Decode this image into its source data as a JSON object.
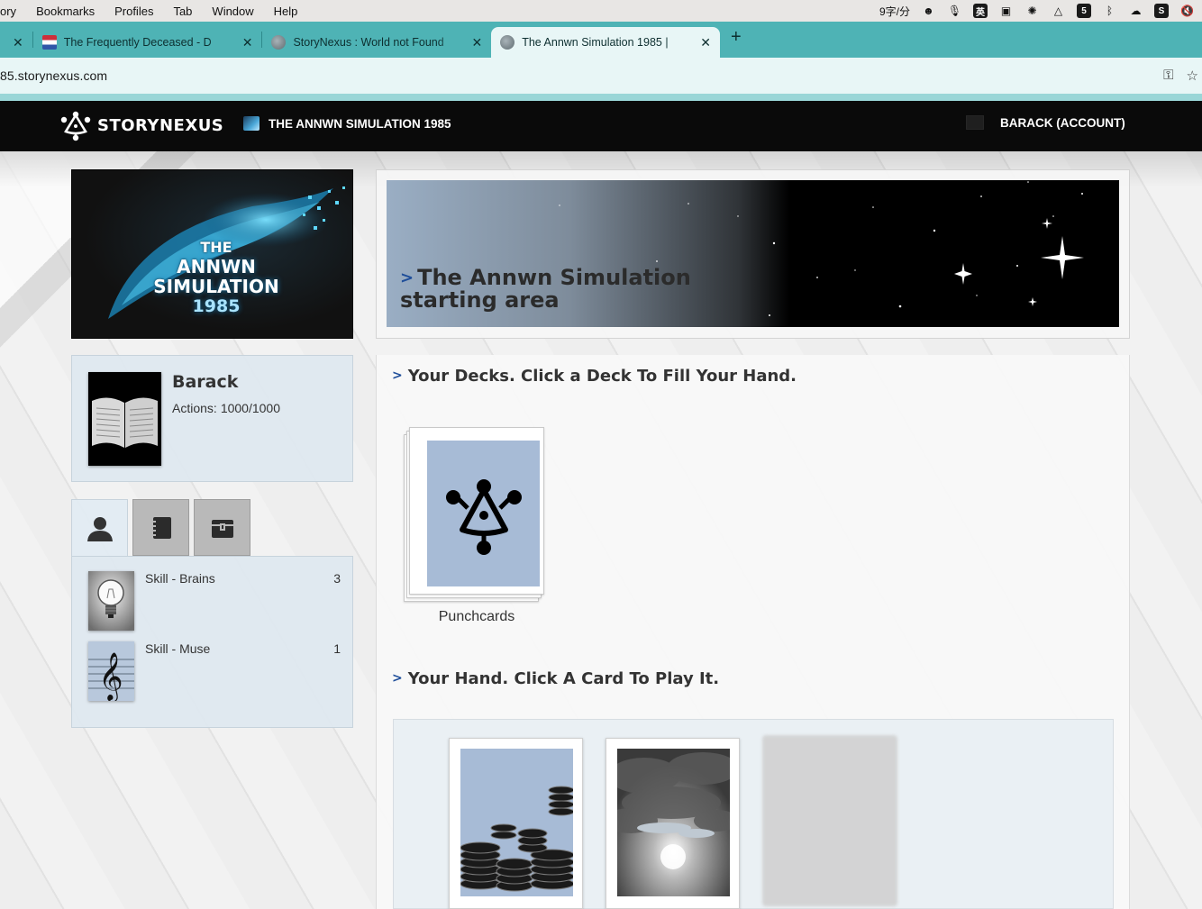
{
  "menubar": {
    "items": [
      "ory",
      "Bookmarks",
      "Profiles",
      "Tab",
      "Window",
      "Help"
    ],
    "tray_text": "9字/分",
    "tray_box_1": "英",
    "tray_box_2": "5"
  },
  "tabs": [
    {
      "title": "The Frequently Deceased - D",
      "favicon": "flag-icon",
      "active": false
    },
    {
      "title": "StoryNexus : World not Found",
      "favicon": "globe-icon",
      "active": false
    },
    {
      "title": "The Annwn Simulation 1985 |",
      "favicon": "globe-icon",
      "active": true
    }
  ],
  "address_bar": {
    "url": "85.storynexus.com"
  },
  "site_header": {
    "logo_text": "STORYNEXUS",
    "world_name": "THE ANNWN SIMULATION 1985",
    "account_label": "BARACK (ACCOUNT)"
  },
  "world_banner": {
    "line1": "THE",
    "line2": "ANNWN",
    "line3": "SIMULATION",
    "line4": "1985"
  },
  "character": {
    "name": "Barack",
    "actions_label": "Actions:",
    "actions_value": "1000/1000"
  },
  "qualities": [
    {
      "name": "Skill - Brains",
      "level": "3",
      "icon": "lightbulb-icon"
    },
    {
      "name": "Skill - Muse",
      "level": "1",
      "icon": "treble-clef-icon"
    }
  ],
  "area": {
    "chevron": ">",
    "title": "The Annwn Simulation starting area"
  },
  "decks": {
    "heading": "Your Decks. Click a Deck To Fill Your Hand.",
    "items": [
      {
        "name": "Punchcards",
        "icon": "storynexus-symbol-icon"
      }
    ]
  },
  "hand": {
    "heading": "Your Hand. Click A Card To Play It.",
    "cards": [
      {
        "art": "coins-icon"
      },
      {
        "art": "clouds-icon"
      }
    ]
  },
  "colors": {
    "tab_strip": "#4eb3b5",
    "header_bg": "#0a0a0a",
    "accent_chevron": "#1f4e9a",
    "deck_art_bg": "#a7bbd6"
  }
}
